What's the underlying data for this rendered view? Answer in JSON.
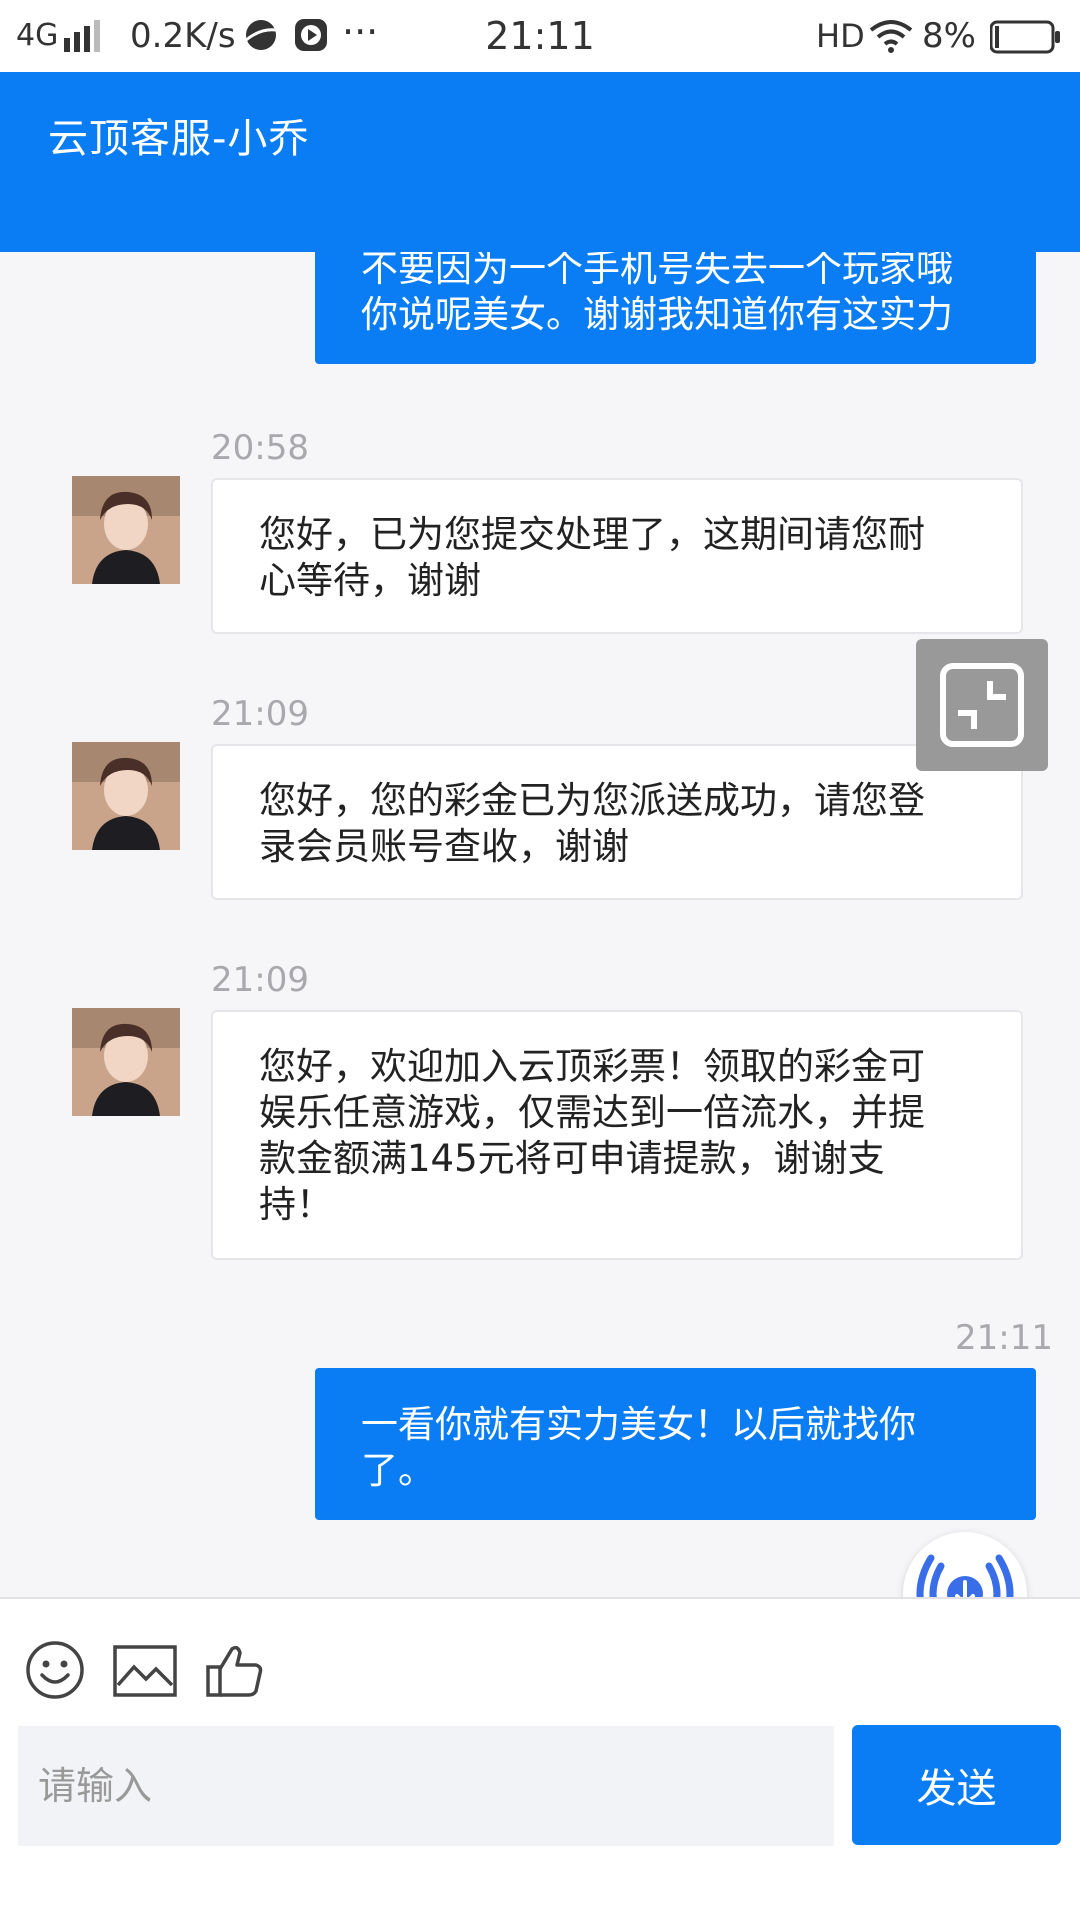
{
  "status_bar": {
    "network": "4G",
    "speed": "0.2K/s",
    "more": "···",
    "time": "21:11",
    "hd": "HD",
    "battery": "8%"
  },
  "header": {
    "title": "云顶客服-小乔"
  },
  "messages": [
    {
      "side": "right",
      "lines": [
        "不要因为一个手机号失去一个玩家哦",
        "你说呢美女。谢谢我知道你有这实力"
      ]
    },
    {
      "side": "left",
      "time": "20:58",
      "lines": [
        "您好，已为您提交处理了，这期间请您耐",
        "心等待，谢谢"
      ]
    },
    {
      "side": "left",
      "time": "21:09",
      "lines": [
        "您好，您的彩金已为您派送成功，请您登",
        "录会员账号查收，谢谢"
      ]
    },
    {
      "side": "left",
      "time": "21:09",
      "lines": [
        "您好，欢迎加入云顶彩票！领取的彩金可",
        "娱乐任意游戏，仅需达到一倍流水，并提",
        "款金额满145元将可申请提款，谢谢支",
        "持！"
      ]
    },
    {
      "side": "right",
      "time": "21:11",
      "lines": [
        "一看你就有实力美女！以后就找你",
        "了。"
      ]
    }
  ],
  "toolbar": {
    "emoji_icon": "smiley-icon",
    "image_icon": "image-icon",
    "like_icon": "thumbs-up-icon"
  },
  "composer": {
    "placeholder": "请输入",
    "send_label": "发送"
  },
  "colors": {
    "brand": "#0a7df5",
    "float_button": "#999999"
  }
}
